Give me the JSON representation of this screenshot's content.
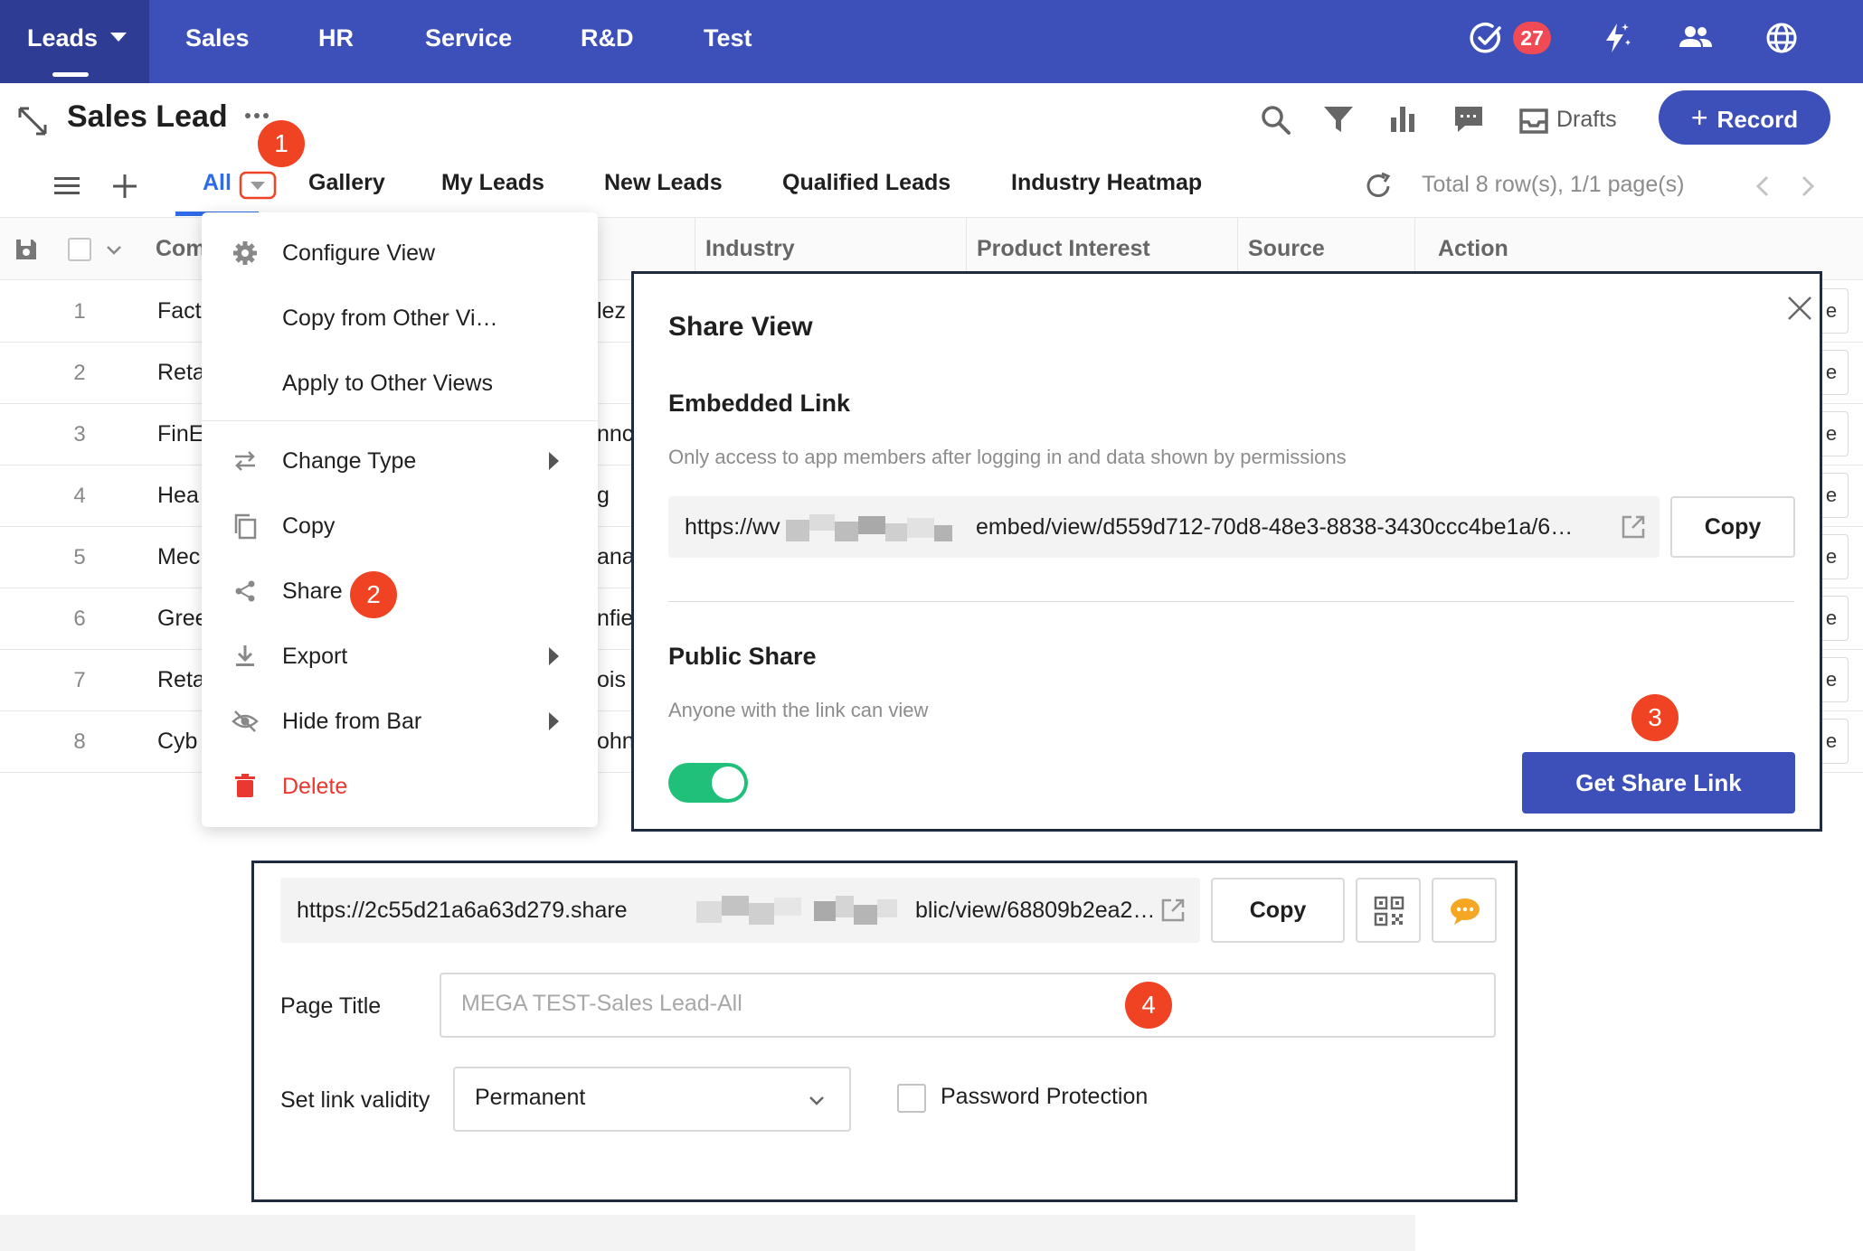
{
  "nav": {
    "items": [
      "Leads",
      "Sales",
      "HR",
      "Service",
      "R&D",
      "Test"
    ],
    "notification_count": "27",
    "icons": [
      "check-circle-icon",
      "lightning-icon",
      "users-icon",
      "globe-icon"
    ]
  },
  "header": {
    "title": "Sales Lead",
    "drafts_label": "Drafts",
    "record_label": "Record"
  },
  "tabs": {
    "items": [
      "All",
      "Gallery",
      "My Leads",
      "New Leads",
      "Qualified Leads",
      "Industry Heatmap"
    ],
    "active": "All",
    "pager": "Total 8 row(s), 1/1 page(s)"
  },
  "table": {
    "columns": [
      "Com",
      "Industry",
      "Product Interest",
      "Source",
      "Action"
    ],
    "rows": [
      {
        "num": "1",
        "company": "Fact",
        "contact": "lez"
      },
      {
        "num": "2",
        "company": "Reta",
        "contact": ""
      },
      {
        "num": "3",
        "company": "FinE",
        "contact": "nnc"
      },
      {
        "num": "4",
        "company": "Hea",
        "contact": "g"
      },
      {
        "num": "5",
        "company": "Mec",
        "contact": "ana"
      },
      {
        "num": "6",
        "company": "Gree",
        "contact": "nfie"
      },
      {
        "num": "7",
        "company": "Reta",
        "contact": "ois"
      },
      {
        "num": "8",
        "company": "Cyb",
        "contact": "ohn"
      }
    ],
    "action_label": "e"
  },
  "menu": {
    "configure_view": "Configure View",
    "copy_from_other": "Copy from Other Vi…",
    "apply_to_other": "Apply to Other Views",
    "change_type": "Change Type",
    "copy": "Copy",
    "share": "Share",
    "export": "Export",
    "hide_from_bar": "Hide from Bar",
    "delete": "Delete"
  },
  "callouts": [
    "1",
    "2",
    "3",
    "4"
  ],
  "share_dialog": {
    "title": "Share View",
    "embedded_title": "Embedded Link",
    "embedded_desc": "Only access to app members after logging in and data shown by permissions",
    "embedded_url_start": "https://wv",
    "embedded_url_end": "embed/view/d559d712-70d8-48e3-8838-3430ccc4be1a/6…",
    "copy_label": "Copy",
    "public_title": "Public Share",
    "public_desc": "Anyone with the link can view",
    "get_link_label": "Get Share Link"
  },
  "public_panel": {
    "url_start": "https://2c55d21a6a63d279.share",
    "url_end": "blic/view/68809b2ea2…",
    "copy_label": "Copy",
    "page_title_label": "Page Title",
    "page_title_placeholder": "MEGA TEST-Sales Lead-All",
    "validity_label": "Set link validity",
    "validity_value": "Permanent",
    "password_label": "Password Protection"
  },
  "colors": {
    "nav_bg": "#3d4fb8",
    "nav_active": "#2e3c94",
    "accent": "#2f6be8",
    "primary": "#3d4fb8",
    "danger": "#e8382f",
    "callout": "#f04323",
    "toggle_on": "#21c07a"
  }
}
